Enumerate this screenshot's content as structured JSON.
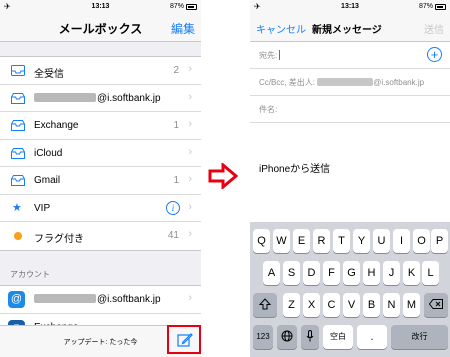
{
  "left": {
    "status": {
      "time": "13:13",
      "battery": "87%"
    },
    "nav": {
      "title": "メールボックス",
      "edit": "編集"
    },
    "mailboxes": [
      {
        "label": "全受信",
        "count": "2"
      },
      {
        "label": "@i.softbank.jp",
        "count": ""
      },
      {
        "label": "Exchange",
        "count": "1"
      },
      {
        "label": "iCloud",
        "count": ""
      },
      {
        "label": "Gmail",
        "count": "1"
      },
      {
        "label": "VIP",
        "count": ""
      },
      {
        "label": "フラグ付き",
        "count": "41"
      }
    ],
    "accounts_header": "アカウント",
    "accounts": [
      {
        "label": "@i.softbank.jp"
      },
      {
        "label": "Exchange"
      }
    ],
    "toolbar": {
      "updated": "アップデート: たった今"
    }
  },
  "right": {
    "status": {
      "time": "13:13",
      "battery": "87%"
    },
    "nav": {
      "cancel": "キャンセル",
      "title": "新規メッセージ",
      "send": "送信"
    },
    "fields": {
      "to": "宛先:",
      "cc": "Cc/Bcc, 差出人:",
      "cc_value": "@i.softbank.jp",
      "subject": "件名:"
    },
    "body": "iPhoneから送信",
    "keyboard": {
      "row1": [
        "Q",
        "W",
        "E",
        "R",
        "T",
        "Y",
        "U",
        "I",
        "O",
        "P"
      ],
      "row2": [
        "A",
        "S",
        "D",
        "F",
        "G",
        "H",
        "J",
        "K",
        "L"
      ],
      "row3": [
        "Z",
        "X",
        "C",
        "V",
        "B",
        "N",
        "M"
      ],
      "num": "123",
      "space": "空白",
      "dot": ".",
      "return": "改行"
    }
  },
  "colors": {
    "accent": "#157efb",
    "highlight": "#e60012"
  }
}
